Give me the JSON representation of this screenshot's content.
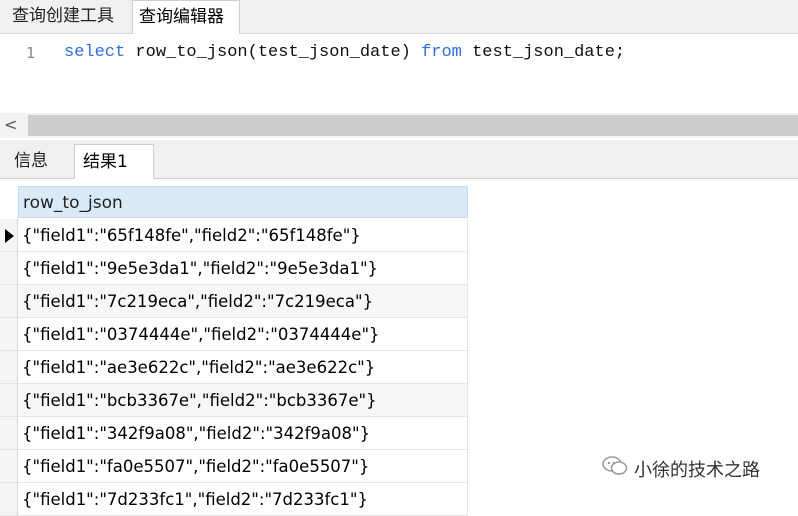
{
  "top_tabs": [
    {
      "label": "查询创建工具"
    },
    {
      "label": "查询编辑器"
    }
  ],
  "editor": {
    "line_number": "1",
    "tokens": {
      "kw_select": "select",
      "mid1": " row_to_json(test_json_date) ",
      "kw_from": "from",
      "mid2": " test_json_date;"
    }
  },
  "scrollbar": {
    "left_arrow": "<"
  },
  "result_tabs": [
    {
      "label": "信息"
    },
    {
      "label": "结果1"
    }
  ],
  "grid": {
    "column_header": "row_to_json",
    "rows": [
      "{\"field1\":\"65f148fe\",\"field2\":\"65f148fe\"}",
      "{\"field1\":\"9e5e3da1\",\"field2\":\"9e5e3da1\"}",
      "{\"field1\":\"7c219eca\",\"field2\":\"7c219eca\"}",
      "{\"field1\":\"0374444e\",\"field2\":\"0374444e\"}",
      "{\"field1\":\"ae3e622c\",\"field2\":\"ae3e622c\"}",
      "{\"field1\":\"bcb3367e\",\"field2\":\"bcb3367e\"}",
      "{\"field1\":\"342f9a08\",\"field2\":\"342f9a08\"}",
      "{\"field1\":\"fa0e5507\",\"field2\":\"fa0e5507\"}",
      "{\"field1\":\"7d233fc1\",\"field2\":\"7d233fc1\"}"
    ]
  },
  "watermark": {
    "text": "小徐的技术之路"
  },
  "colors": {
    "keyword": "#2f6fd6",
    "header_bg": "#dbeaf7"
  }
}
